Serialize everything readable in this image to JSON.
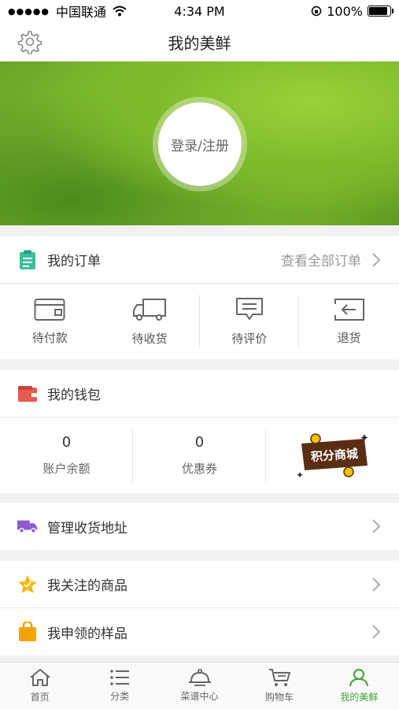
{
  "status": {
    "carrier": "中国联通",
    "time": "4:34 PM",
    "battery": "100%"
  },
  "nav": {
    "title": "我的美鲜"
  },
  "hero": {
    "login_label": "登录/注册"
  },
  "orders": {
    "title": "我的订单",
    "view_all": "查看全部订单",
    "items": [
      {
        "label": "待付款",
        "icon": "wallet-card-icon"
      },
      {
        "label": "待收货",
        "icon": "truck-icon"
      },
      {
        "label": "待评价",
        "icon": "comment-icon"
      },
      {
        "label": "退货",
        "icon": "return-icon"
      }
    ]
  },
  "wallet": {
    "title": "我的钱包",
    "balance": {
      "value": "0",
      "label": "账户余额"
    },
    "coupon": {
      "value": "0",
      "label": "优惠券"
    },
    "shop_badge": "积分商城"
  },
  "address": {
    "label": "管理收货地址"
  },
  "favorites": {
    "label": "我关注的商品"
  },
  "samples": {
    "label": "我申领的样品"
  },
  "tabs": [
    {
      "label": "首页",
      "icon": "home-icon",
      "active": false
    },
    {
      "label": "分类",
      "icon": "list-icon",
      "active": false
    },
    {
      "label": "菜谱中心",
      "icon": "cloche-icon",
      "active": false
    },
    {
      "label": "购物车",
      "icon": "cart-icon",
      "active": false
    },
    {
      "label": "我的美鲜",
      "icon": "user-icon",
      "active": true
    }
  ],
  "colors": {
    "accent": "#3aa535",
    "order_icon": "#3bbf9a",
    "wallet_icon": "#e85a4f",
    "truck_icon": "#8a5bd1",
    "star_icon": "#f5b800",
    "bag_icon": "#f5a300"
  }
}
